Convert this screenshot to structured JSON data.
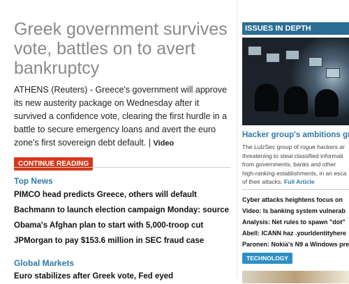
{
  "main": {
    "headline": "Greek government survives vote, battles on to avert bankruptcy",
    "summary": "ATHENS (Reuters) - Greece's government will approve its new austerity package on Wednesday after it survived a confidence vote, clearing the first hurdle in a battle to secure emergency loans and avert the euro zone's first sovereign debt default. |",
    "video_label": "Video",
    "continue_label": "CONTINUE READING"
  },
  "top_news": {
    "title": "Top News",
    "items": [
      "PIMCO head predicts Greece, others will default",
      "Bachmann to launch election campaign Monday: source",
      "Obama's Afghan plan to start with 5,000-troop cut",
      "JPMorgan to pay $153.6 million in SEC fraud case"
    ]
  },
  "global_markets": {
    "title": "Global Markets",
    "first_item": "Euro stabilizes after Greek vote, Fed eyed"
  },
  "sidebar": {
    "header": "ISSUES IN DEPTH",
    "feature_title": "Hacker group's ambitions gro",
    "feature_body_lines": [
      "The LulzSec group of rogue hackers ar",
      "threatening to steal classified informati",
      "from governments, banks and other",
      "high-ranking establishments, in an esca",
      "of their attacks."
    ],
    "full_article_label": "Full Article",
    "links": [
      "Cyber attacks heightens focus on",
      "Video: Is banking system vulnerab",
      "Analysis: Net rules to spawn \"dot\"",
      "Abell: ICANN haz .yourIdentityhere",
      "Paronen: Nokia's N9 a Windows pre"
    ],
    "tag_label": "TECHNOLOGY"
  }
}
